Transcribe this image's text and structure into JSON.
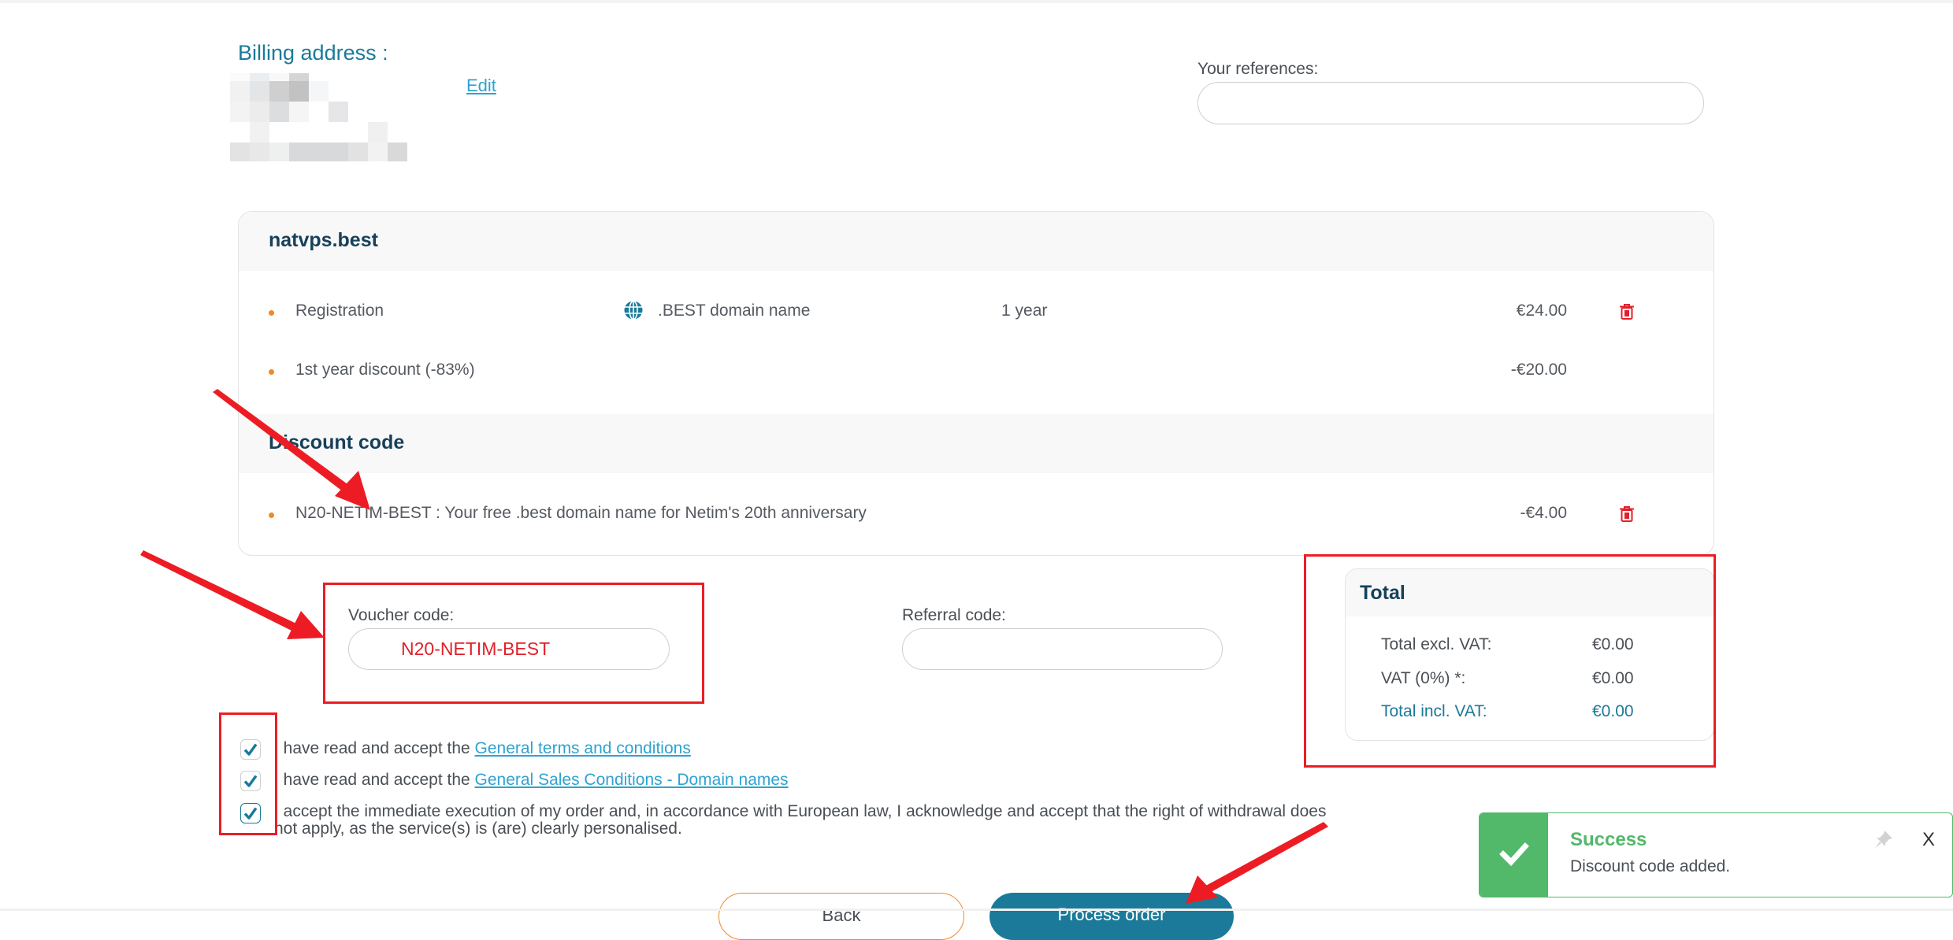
{
  "billing": {
    "title": "Billing address :",
    "edit_label": "Edit"
  },
  "references": {
    "label": "Your references:",
    "value": "",
    "placeholder": ""
  },
  "order": {
    "domain_title": "natvps.best",
    "items": [
      {
        "label": "Registration",
        "icon": "globe-icon",
        "product": ".BEST domain name",
        "period": "1 year",
        "price": "€24.00",
        "deletable": true
      },
      {
        "label": "1st year discount (-83%)",
        "price": "-€20.00",
        "deletable": false
      }
    ],
    "discount_section_title": "Discount code",
    "discount_items": [
      {
        "label": "N20-NETIM-BEST : Your free .best domain name for Netim's 20th anniversary",
        "price": "-€4.00",
        "deletable": true
      }
    ]
  },
  "voucher": {
    "label": "Voucher code:",
    "value": "N20-NETIM-BEST"
  },
  "referral": {
    "label": "Referral code:",
    "value": ""
  },
  "total": {
    "title": "Total",
    "rows": [
      {
        "label": "Total excl. VAT:",
        "value": "€0.00"
      },
      {
        "label": "VAT (0%) *:",
        "value": "€0.00"
      },
      {
        "label": "Total incl. VAT:",
        "value": "€0.00"
      }
    ]
  },
  "terms": [
    {
      "checked": true,
      "prefix": "I have read and accept the ",
      "link": "General terms and conditions"
    },
    {
      "checked": true,
      "prefix": "I have read and accept the ",
      "link": "General Sales Conditions - Domain names"
    },
    {
      "checked": true,
      "line1": "I accept the immediate execution of my order and, in accordance with European law, I acknowledge and accept that the right of withdrawal does",
      "line2": "not apply, as the service(s) is (are) clearly personalised."
    }
  ],
  "buttons": {
    "back": "Back",
    "process": "Process order"
  },
  "toast": {
    "title": "Success",
    "message": "Discount code added.",
    "close": "X"
  },
  "colors": {
    "brand": "#1b7a99",
    "link": "#2ea3cf",
    "accent_orange": "#f08a24",
    "success": "#52b86a",
    "danger": "#e0212b",
    "annotation": "#ed1c24"
  }
}
